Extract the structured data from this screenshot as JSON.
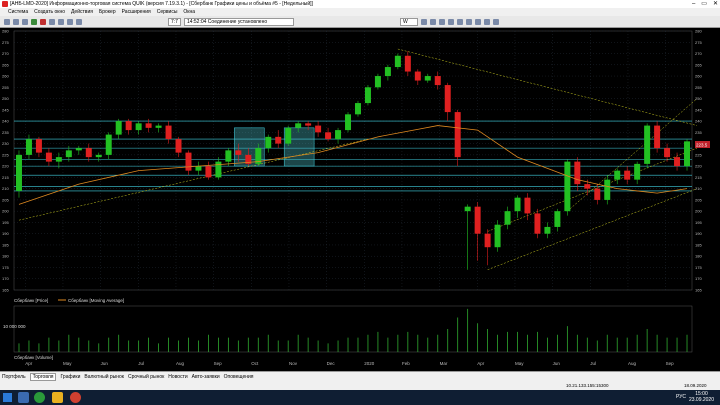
{
  "window": {
    "title": "[АНБ-LMD-2020] Информационно-торговая система QUIK (версия 7.19.3.1) - [Сбербанк Графики цены и объёма #5 - [Недельный]]",
    "controls": [
      "–",
      "▭",
      "✕"
    ]
  },
  "menu": [
    "Система",
    "Создать окно",
    "Действия",
    "Брокер",
    "Расширения",
    "Сервисы",
    "Окна"
  ],
  "toolbar": {
    "time_field": "7:7",
    "status_field": "14:52:04  Соединение установлено",
    "period": "W"
  },
  "chart_data": [
    {
      "type": "candlestick",
      "title": "Сбербанк [Price]",
      "legend": [
        "Сбербанк [Price]",
        "Сбербанк [Moving Average]"
      ],
      "ylim": [
        165,
        280
      ],
      "y_ticks": [
        280,
        275,
        270,
        265,
        260,
        255,
        250,
        245,
        240,
        235,
        230,
        225,
        220,
        215,
        210,
        205,
        200,
        195,
        190,
        185,
        180,
        175,
        170,
        165
      ],
      "x_labels": [
        "Apr",
        "May",
        "Jun",
        "Jul",
        "Aug",
        "Sep",
        "Oct",
        "Nov",
        "Dec",
        "2020",
        "Feb",
        "Mar",
        "Apr",
        "May",
        "Jun",
        "Jul",
        "Aug",
        "Sep"
      ],
      "last_price": "223.5",
      "candles": [
        [
          209,
          225,
          206,
          227
        ],
        [
          225,
          232,
          223,
          234
        ],
        [
          232,
          226,
          224,
          233
        ],
        [
          226,
          222,
          220,
          228
        ],
        [
          222,
          224,
          219,
          226
        ],
        [
          224,
          227,
          222,
          229
        ],
        [
          227,
          228,
          225,
          229
        ],
        [
          228,
          224,
          222,
          230
        ],
        [
          224,
          225,
          222,
          226
        ],
        [
          225,
          234,
          223,
          235
        ],
        [
          234,
          240,
          232,
          241
        ],
        [
          240,
          236,
          234,
          241
        ],
        [
          236,
          239,
          234,
          240
        ],
        [
          239,
          237,
          235,
          241
        ],
        [
          237,
          238,
          235,
          239
        ],
        [
          238,
          232,
          230,
          240
        ],
        [
          232,
          226,
          224,
          233
        ],
        [
          226,
          218,
          216,
          227
        ],
        [
          218,
          220,
          216,
          222
        ],
        [
          220,
          215,
          214,
          222
        ],
        [
          215,
          222,
          214,
          224
        ],
        [
          222,
          227,
          220,
          228
        ],
        [
          227,
          225,
          222,
          230
        ],
        [
          225,
          221,
          220,
          228
        ],
        [
          221,
          228,
          220,
          230
        ],
        [
          228,
          233,
          226,
          234
        ],
        [
          233,
          230,
          228,
          236
        ],
        [
          230,
          237,
          229,
          238
        ],
        [
          237,
          239,
          235,
          240
        ],
        [
          239,
          238,
          236,
          240
        ],
        [
          238,
          235,
          233,
          240
        ],
        [
          235,
          232,
          231,
          237
        ],
        [
          232,
          236,
          230,
          237
        ],
        [
          236,
          243,
          235,
          244
        ],
        [
          243,
          248,
          242,
          249
        ],
        [
          248,
          255,
          247,
          256
        ],
        [
          255,
          260,
          254,
          261
        ],
        [
          260,
          264,
          258,
          265
        ],
        [
          264,
          269,
          263,
          270
        ],
        [
          269,
          262,
          260,
          271
        ],
        [
          262,
          258,
          256,
          263
        ],
        [
          258,
          260,
          257,
          261
        ],
        [
          260,
          256,
          254,
          262
        ],
        [
          256,
          244,
          240,
          257
        ],
        [
          244,
          224,
          220,
          245
        ],
        [
          200,
          202,
          174,
          203
        ],
        [
          202,
          190,
          178,
          204
        ],
        [
          190,
          184,
          176,
          192
        ],
        [
          184,
          194,
          182,
          196
        ],
        [
          194,
          200,
          192,
          202
        ],
        [
          200,
          206,
          197,
          207
        ],
        [
          206,
          199,
          196,
          208
        ],
        [
          199,
          190,
          188,
          201
        ],
        [
          190,
          193,
          188,
          195
        ],
        [
          193,
          200,
          191,
          201
        ],
        [
          200,
          222,
          198,
          223
        ],
        [
          222,
          212,
          209,
          224
        ],
        [
          212,
          210,
          207,
          214
        ],
        [
          210,
          205,
          203,
          212
        ],
        [
          205,
          214,
          203,
          216
        ],
        [
          214,
          218,
          212,
          219
        ],
        [
          218,
          214,
          212,
          220
        ],
        [
          214,
          221,
          212,
          222
        ],
        [
          221,
          238,
          219,
          239
        ],
        [
          238,
          228,
          226,
          240
        ],
        [
          228,
          224,
          222,
          230
        ],
        [
          224,
          220,
          218,
          226
        ],
        [
          220,
          231,
          218,
          232
        ]
      ],
      "moving_average": [
        [
          0,
          203
        ],
        [
          6,
          212
        ],
        [
          12,
          218
        ],
        [
          18,
          220
        ],
        [
          24,
          222
        ],
        [
          30,
          226
        ],
        [
          36,
          233
        ],
        [
          42,
          238
        ],
        [
          46,
          236
        ],
        [
          50,
          224
        ],
        [
          56,
          214
        ],
        [
          60,
          210
        ],
        [
          64,
          208
        ],
        [
          67,
          210
        ]
      ],
      "levels": [
        240,
        232,
        228,
        223,
        220,
        216,
        211,
        209
      ]
    },
    {
      "type": "bar",
      "title": "Сбербанк [Volume]",
      "y_tick_label": "10 000 000",
      "volumes": [
        3,
        4,
        3,
        5,
        4,
        6,
        5,
        4,
        3,
        5,
        6,
        4,
        4,
        5,
        3,
        5,
        4,
        5,
        4,
        6,
        5,
        5,
        4,
        5,
        5,
        6,
        4,
        4,
        6,
        5,
        4,
        3,
        4,
        5,
        5,
        6,
        7,
        5,
        6,
        7,
        6,
        5,
        6,
        8,
        12,
        15,
        10,
        8,
        6,
        7,
        7,
        6,
        7,
        5,
        6,
        9,
        6,
        5,
        4,
        6,
        5,
        5,
        6,
        8,
        6,
        5,
        5,
        6
      ]
    }
  ],
  "bottom_tabs": [
    "Портфель",
    "Торговля",
    "Графики",
    "Валютный рынок",
    "Срочный рынок",
    "Новости",
    "Авто-заявки",
    "Оповещения"
  ],
  "active_tab_index": 1,
  "status": {
    "connection": "10.21.133.155:15300",
    "date": "18.09.2020"
  },
  "taskbar": {
    "language": "РУС",
    "time": "15:00",
    "date": "23.09.2020"
  },
  "colors": {
    "bull": "#22c022",
    "bear": "#e02020",
    "moving_average": "#e08a20",
    "level": "#40d0e0",
    "trend": "#c8c820",
    "grid": "#2a3340"
  }
}
